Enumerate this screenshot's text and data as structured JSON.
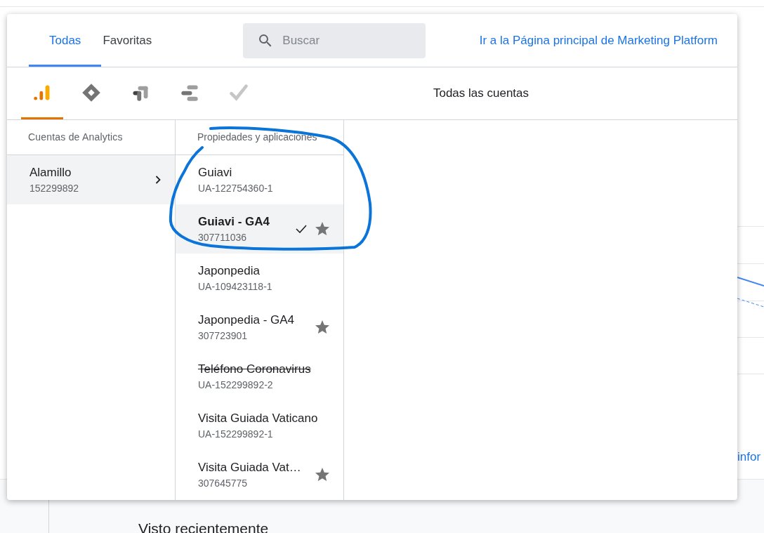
{
  "tabs": [
    {
      "label": "Todas",
      "selected": true
    },
    {
      "label": "Favoritas",
      "selected": false
    }
  ],
  "search": {
    "placeholder": "Buscar"
  },
  "home_link": "Ir a la Página principal de Marketing Platform",
  "products": [
    {
      "kind": "analytics",
      "selected": true
    },
    {
      "kind": "tag-manager",
      "selected": false
    },
    {
      "kind": "optimize",
      "selected": false
    },
    {
      "kind": "data-studio",
      "selected": false
    },
    {
      "kind": "surveys",
      "selected": false
    }
  ],
  "scope_title": "Todas las cuentas",
  "accounts": {
    "heading": "Cuentas de Analytics",
    "items": [
      {
        "name": "Alamillo",
        "id": "152299892",
        "selected": true
      }
    ]
  },
  "properties": {
    "heading": "Propiedades y aplicaciones",
    "items": [
      {
        "name": "Guiavi",
        "id": "UA-122754360-1",
        "selected": false,
        "starred": false,
        "deleted": false
      },
      {
        "name": "Guiavi - GA4",
        "id": "307711036",
        "selected": true,
        "starred": true,
        "deleted": false
      },
      {
        "name": "Japonpedia",
        "id": "UA-109423118-1",
        "selected": false,
        "starred": false,
        "deleted": false
      },
      {
        "name": "Japonpedia - GA4",
        "id": "307723901",
        "selected": false,
        "starred": true,
        "deleted": false
      },
      {
        "name": "Teléfono Coronavirus",
        "id": "UA-152299892-2",
        "selected": false,
        "starred": false,
        "deleted": true
      },
      {
        "name": "Visita Guiada Vaticano",
        "id": "UA-152299892-1",
        "selected": false,
        "starred": false,
        "deleted": false
      },
      {
        "name": "Visita Guiada Vat…",
        "id": "307645775",
        "selected": false,
        "starred": true,
        "deleted": false
      }
    ]
  },
  "background": {
    "link_fragment": "infor",
    "heading": "Visto recientemente"
  }
}
